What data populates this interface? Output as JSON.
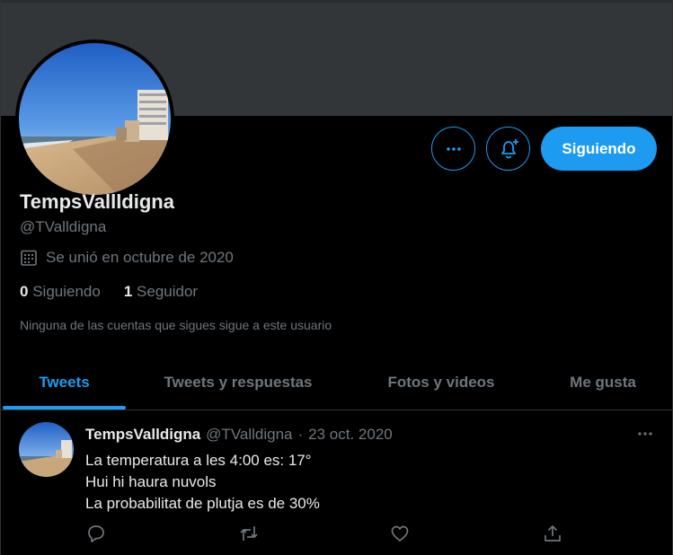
{
  "profile": {
    "display_name": "TempsVallldigna",
    "handle": "@TValldigna",
    "joined": "Se unió en octubre de 2020",
    "following_count": "0",
    "following_label": "Siguiendo",
    "followers_count": "1",
    "followers_label": "Seguidor",
    "mutual_note": "Ninguna de las cuentas que sigues sigue a este usuario",
    "follow_button_label": "Siguiendo"
  },
  "tabs": [
    {
      "label": "Tweets",
      "active": true
    },
    {
      "label": "Tweets y respuestas",
      "active": false
    },
    {
      "label": "Fotos y videos",
      "active": false
    },
    {
      "label": "Me gusta",
      "active": false
    }
  ],
  "tweet": {
    "author_name": "TempsValldigna",
    "author_handle": "@TValldigna",
    "separator": "·",
    "date": "23 oct. 2020",
    "lines": [
      "La temperatura a les 4:00 es: 17°",
      "Hui hi haura nuvols",
      "La probabilitat de plutja es de 30%"
    ]
  },
  "icons": {
    "more": "more-icon",
    "notify": "bell-plus-icon",
    "calendar": "calendar-icon",
    "reply": "reply-icon",
    "retweet": "retweet-icon",
    "like": "like-icon",
    "share": "share-icon"
  },
  "colors": {
    "accent": "#1d9bf0",
    "background": "#000000",
    "banner": "#333639",
    "muted_text": "#6e767d",
    "primary_text": "#e7e9ea"
  }
}
